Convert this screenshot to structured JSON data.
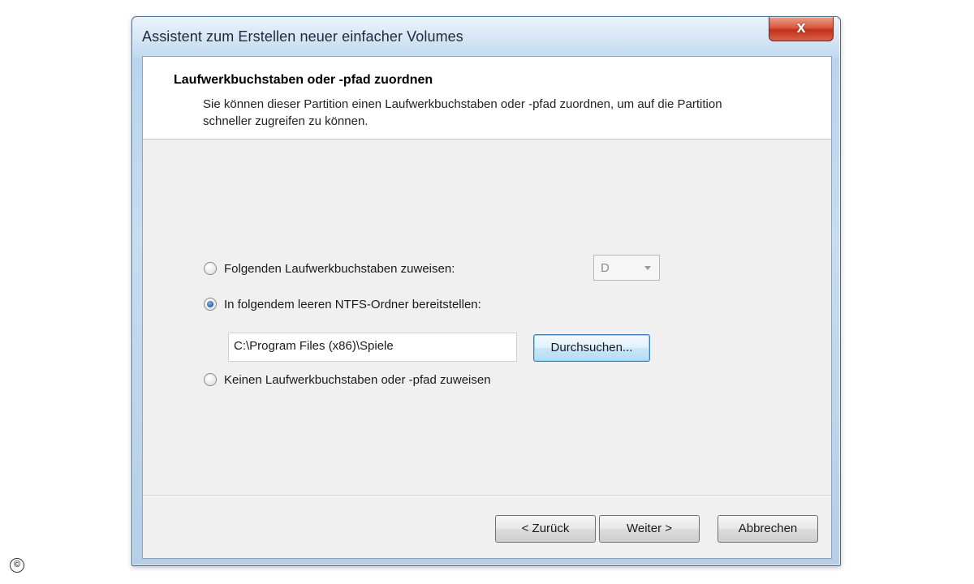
{
  "window": {
    "title": "Assistent zum Erstellen neuer einfacher Volumes",
    "close_glyph": "x"
  },
  "header": {
    "title": "Laufwerkbuchstaben oder -pfad zuordnen",
    "description": "Sie können dieser Partition einen Laufwerkbuchstaben oder -pfad zuordnen, um auf die Partition schneller zugreifen zu können."
  },
  "options": {
    "assign_letter": {
      "label": "Folgenden Laufwerkbuchstaben zuweisen:",
      "checked": false
    },
    "mount_folder": {
      "label": "In folgendem leeren NTFS-Ordner bereitstellen:",
      "checked": true,
      "path_value": "C:\\Program Files (x86)\\Spiele",
      "browse_label": "Durchsuchen..."
    },
    "no_assign": {
      "label": "Keinen Laufwerkbuchstaben oder -pfad zuweisen",
      "checked": false
    },
    "drive_letter_selected": "D"
  },
  "footer": {
    "back_label": "< Zurück",
    "next_label": "Weiter >",
    "cancel_label": "Abbrechen"
  },
  "watermark": {
    "symbol": "©"
  }
}
